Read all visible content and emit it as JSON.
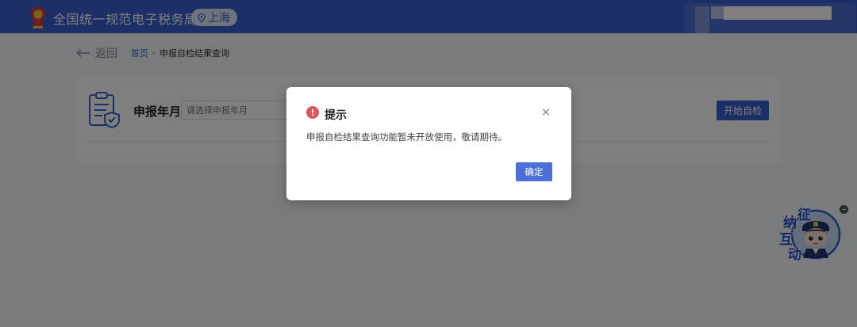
{
  "header": {
    "app_title": "全国统一规范电子税务局",
    "region": "上海",
    "logo_icon": "tax-emblem-icon",
    "region_icon": "location-pin-icon"
  },
  "nav": {
    "back_label": "返回",
    "breadcrumb": {
      "home": "首页",
      "separator": "›",
      "current": "申报自检结果查询"
    }
  },
  "form": {
    "period_label": "申报年月",
    "period_placeholder": "请选择申报年月",
    "start_button": "开始自检",
    "icon": "clipboard-shield-icon"
  },
  "mascot": {
    "chars": [
      "征",
      "纳",
      "互",
      "动"
    ]
  },
  "modal": {
    "title": "提示",
    "warning_icon_glyph": "!",
    "close_glyph": "×",
    "message": "申报自检结果查询功能暂未开放使用，敬请期待。",
    "confirm_label": "确定"
  },
  "colors": {
    "brand": "#3a5fcf",
    "warning": "#e0555c",
    "confirm": "#4d6fd9"
  }
}
